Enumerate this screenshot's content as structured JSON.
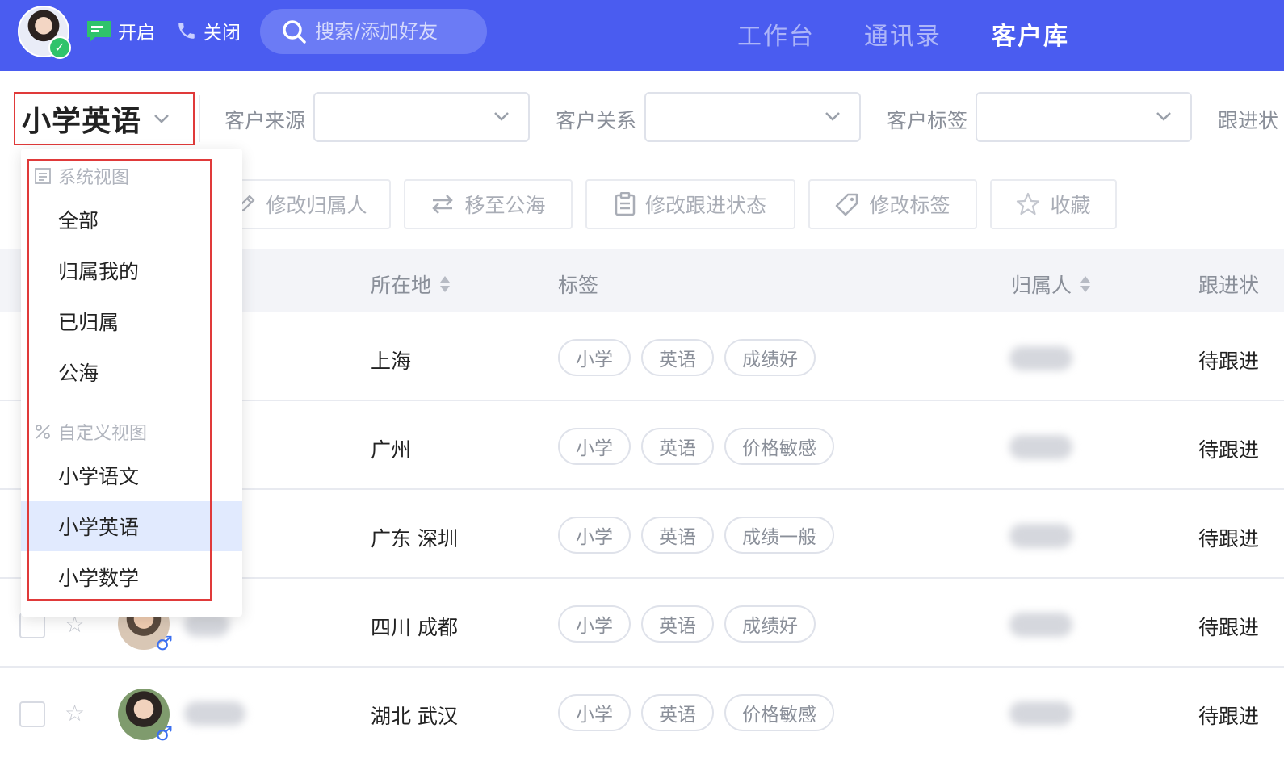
{
  "topbar": {
    "toggle_on_label": "开启",
    "toggle_off_label": "关闭",
    "search_placeholder": "搜索/添加好友",
    "tabs": [
      {
        "label": "工作台",
        "active": false
      },
      {
        "label": "通讯录",
        "active": false
      },
      {
        "label": "客户库",
        "active": true
      }
    ]
  },
  "view_selector": {
    "current": "小学英语"
  },
  "filters": [
    {
      "label": "客户来源",
      "value": ""
    },
    {
      "label": "客户关系",
      "value": ""
    },
    {
      "label": "客户标签",
      "value": ""
    },
    {
      "label": "跟进状"
    }
  ],
  "actions": [
    {
      "label": "修改归属人",
      "icon": "user-edit-icon"
    },
    {
      "label": "移至公海",
      "icon": "swap-icon"
    },
    {
      "label": "修改跟进状态",
      "icon": "clipboard-icon"
    },
    {
      "label": "修改标签",
      "icon": "tag-icon"
    },
    {
      "label": "收藏",
      "icon": "star-icon"
    }
  ],
  "table": {
    "headers": {
      "location": "所在地",
      "tags": "标签",
      "owner": "归属人",
      "status": "跟进状"
    },
    "rows": [
      {
        "location": "上海",
        "tags": [
          "小学",
          "英语",
          "成绩好"
        ],
        "status": "待跟进"
      },
      {
        "location": "广州",
        "tags": [
          "小学",
          "英语",
          "价格敏感"
        ],
        "status": "待跟进"
      },
      {
        "location": "广东 深圳",
        "tags": [
          "小学",
          "英语",
          "成绩一般"
        ],
        "status": "待跟进"
      },
      {
        "location": "四川 成都",
        "tags": [
          "小学",
          "英语",
          "成绩好"
        ],
        "status": "待跟进"
      },
      {
        "location": "湖北 武汉",
        "tags": [
          "小学",
          "英语",
          "价格敏感"
        ],
        "status": "待跟进"
      }
    ]
  },
  "dropdown": {
    "system_group_label": "系统视图",
    "system_items": [
      "全部",
      "归属我的",
      "已归属",
      "公海"
    ],
    "custom_group_label": "自定义视图",
    "custom_items": [
      "小学语文",
      "小学英语",
      "小学数学"
    ],
    "selected": "小学英语"
  },
  "colors": {
    "topbar": "#4a5cf0",
    "highlight_border": "#e03a3a",
    "selected_item_bg": "#e1eafe",
    "online_badge": "#2fc36b",
    "toggle_icon": "#2fc36b"
  }
}
